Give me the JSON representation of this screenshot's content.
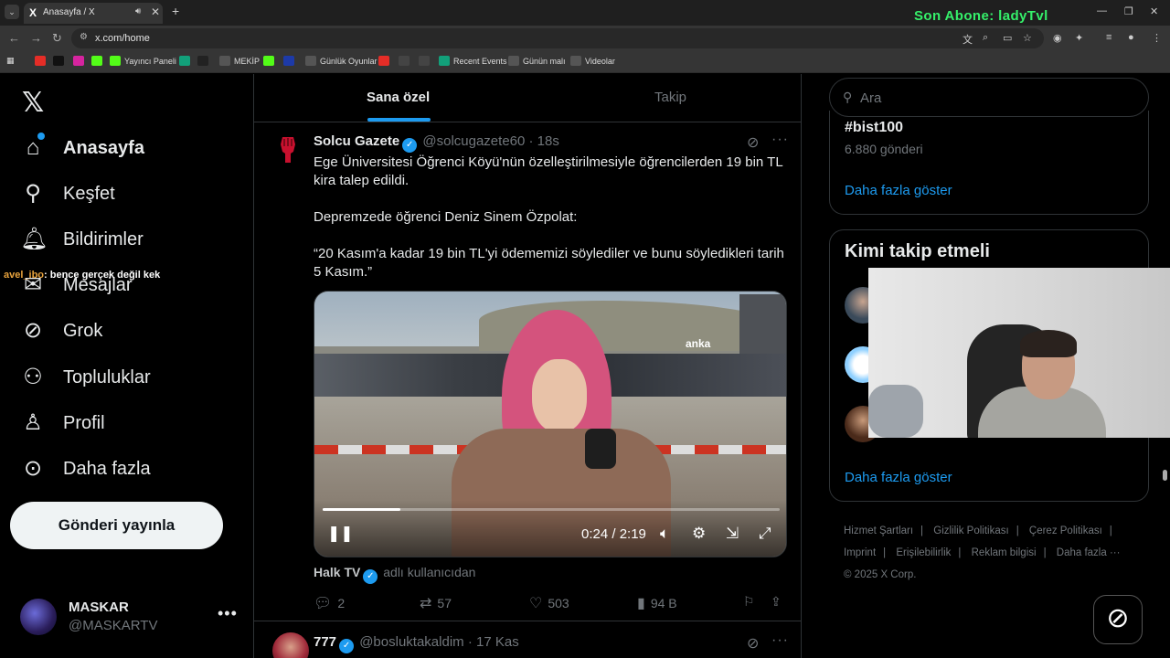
{
  "browser": {
    "tab_title": "Anasayfa / X",
    "tab_favicon": "X",
    "url": "x.com/home",
    "overlay_text": "Son Abone: ladyTvl",
    "bookmarks": [
      {
        "label": "",
        "color": "#e52d27"
      },
      {
        "label": "",
        "color": "#111111"
      },
      {
        "label": "",
        "color": "#d6249f"
      },
      {
        "label": "",
        "color": "#53fc18"
      },
      {
        "label": "Yayıncı Paneli",
        "color": "#53fc18"
      },
      {
        "label": "",
        "color": "#12a07a"
      },
      {
        "label": "",
        "color": "#222222"
      },
      {
        "label": "MEKİP",
        "color": "#555555"
      },
      {
        "label": "",
        "color": "#53fc18"
      },
      {
        "label": "",
        "color": "#1d3aa8"
      },
      {
        "label": "Günlük Oyunlar",
        "color": "#555555"
      },
      {
        "label": "",
        "color": "#e52d27"
      },
      {
        "label": "",
        "color": "#444444"
      },
      {
        "label": "",
        "color": "#444444"
      },
      {
        "label": "Recent Events",
        "color": "#12a07a"
      },
      {
        "label": "Günün malı",
        "color": "#555555"
      },
      {
        "label": "Videolar",
        "color": "#555555"
      }
    ]
  },
  "nav": {
    "items": [
      {
        "label": "Anasayfa",
        "icon": "home-icon"
      },
      {
        "label": "Keşfet",
        "icon": "search-icon"
      },
      {
        "label": "Bildirimler",
        "icon": "bell-icon"
      },
      {
        "label": "Mesajlar",
        "icon": "mail-icon"
      },
      {
        "label": "Grok",
        "icon": "grok-icon"
      },
      {
        "label": "Topluluklar",
        "icon": "communities-icon"
      },
      {
        "label": "Profil",
        "icon": "profile-icon"
      },
      {
        "label": "Daha fazla",
        "icon": "more-circle-icon"
      }
    ],
    "post_button": "Gönderi yayınla"
  },
  "chat_overlay": {
    "user": "avel_ibo",
    "message": ": bence gerçek değil kek"
  },
  "account": {
    "name": "MASKAR",
    "handle": "@MASKARTV"
  },
  "feed": {
    "tabs": [
      "Sana özel",
      "Takip"
    ],
    "tweet": {
      "name": "Solcu Gazete",
      "handle": "@solcugazete60",
      "time": "· 18s",
      "paragraphs": [
        "Ege Üniversitesi Öğrenci Köyü'nün özelleştirilmesiyle öğrencilerden 19 bin TL kira talep edildi.",
        "Depremzede öğrenci Deniz Sinem Özpolat:",
        "“20 Kasım'a kadar 19 bin TL'yi ödememizi söylediler ve bunu söyledikleri tarih 5 Kasım.”"
      ],
      "video": {
        "time": "0:24 / 2:19",
        "progress": 0.17,
        "watermark": "anka"
      },
      "source_name": "Halk TV",
      "source_suffix": "adlı kullanıcıdan",
      "replies": "2",
      "reposts": "57",
      "likes": "503",
      "views": "94 B"
    },
    "tweet2": {
      "name": "777",
      "handle": "@bosluktakaldim",
      "time": "· 17 Kas"
    }
  },
  "right": {
    "search_placeholder": "Ara",
    "trend_tag": "#bist100",
    "trend_count": "6.880 gönderi",
    "show_more": "Daha fazla göster",
    "who_to_follow": "Kimi takip etmeli",
    "footer": [
      "Hizmet Şartları",
      "Gizlilik Politikası",
      "Çerez Politikası",
      "Imprint",
      "Erişilebilirlik",
      "Reklam bilgisi",
      "Daha fazla ···",
      "© 2025 X Corp."
    ]
  },
  "colors": {
    "accent": "#1d9bf0",
    "overlay_green": "#35f06a"
  }
}
